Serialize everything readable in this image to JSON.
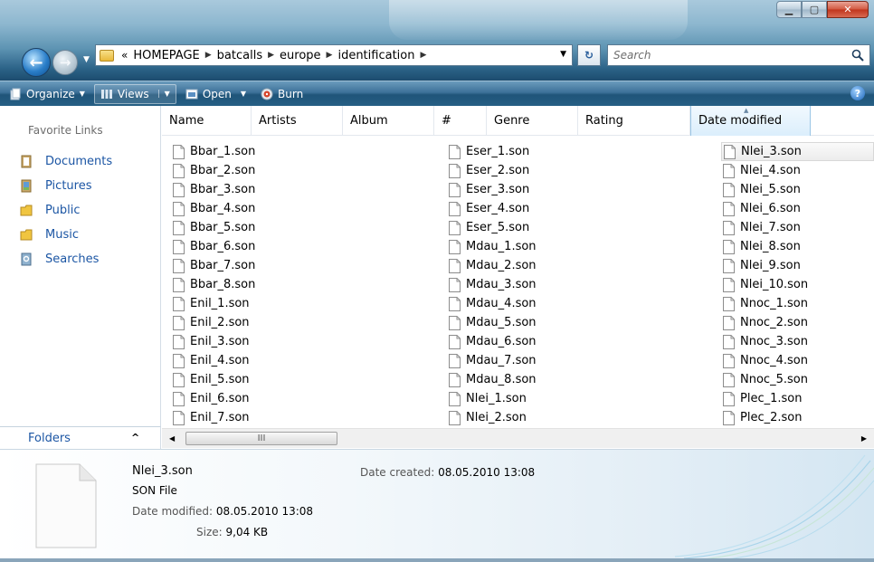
{
  "address": {
    "overflow": "«",
    "crumbs": [
      "HOMEPAGE",
      "batcalls",
      "europe",
      "identification"
    ]
  },
  "search": {
    "placeholder": "Search"
  },
  "commands": {
    "organize": "Organize",
    "views": "Views",
    "open": "Open",
    "burn": "Burn"
  },
  "nav": {
    "heading": "Favorite Links",
    "items": [
      {
        "label": "Documents",
        "icon": "documents-icon"
      },
      {
        "label": "Pictures",
        "icon": "pictures-icon"
      },
      {
        "label": "Public",
        "icon": "public-folder-icon"
      },
      {
        "label": "Music",
        "icon": "music-folder-icon"
      },
      {
        "label": "Searches",
        "icon": "searches-icon"
      }
    ],
    "folders_label": "Folders"
  },
  "columns": [
    "Name",
    "Artists",
    "Album",
    "#",
    "Genre",
    "Rating",
    "Date modified"
  ],
  "files": {
    "col1": [
      "Bbar_1.son",
      "Bbar_2.son",
      "Bbar_3.son",
      "Bbar_4.son",
      "Bbar_5.son",
      "Bbar_6.son",
      "Bbar_7.son",
      "Bbar_8.son",
      "Enil_1.son",
      "Enil_2.son",
      "Enil_3.son",
      "Enil_4.son",
      "Enil_5.son",
      "Enil_6.son",
      "Enil_7.son"
    ],
    "col2": [
      "Eser_1.son",
      "Eser_2.son",
      "Eser_3.son",
      "Eser_4.son",
      "Eser_5.son",
      "Mdau_1.son",
      "Mdau_2.son",
      "Mdau_3.son",
      "Mdau_4.son",
      "Mdau_5.son",
      "Mdau_6.son",
      "Mdau_7.son",
      "Mdau_8.son",
      "Nlei_1.son",
      "Nlei_2.son"
    ],
    "col3": [
      "Nlei_3.son",
      "Nlei_4.son",
      "Nlei_5.son",
      "Nlei_6.son",
      "Nlei_7.son",
      "Nlei_8.son",
      "Nlei_9.son",
      "Nlei_10.son",
      "Nnoc_1.son",
      "Nnoc_2.son",
      "Nnoc_3.son",
      "Nnoc_4.son",
      "Nnoc_5.son",
      "Plec_1.son",
      "Plec_2.son"
    ],
    "selected": "Nlei_3.son"
  },
  "scrollbar": {
    "grip": "III"
  },
  "details": {
    "name": "Nlei_3.son",
    "type": "SON File",
    "date_modified_label": "Date modified:",
    "date_modified": "08.05.2010 13:08",
    "size_label": "Size:",
    "size": "9,04 KB",
    "date_created_label": "Date created:",
    "date_created": "08.05.2010 13:08"
  },
  "colors": {
    "link_blue": "#1c56a4",
    "command_bar": "#2a628a",
    "selected_header": "#dbeefc"
  }
}
